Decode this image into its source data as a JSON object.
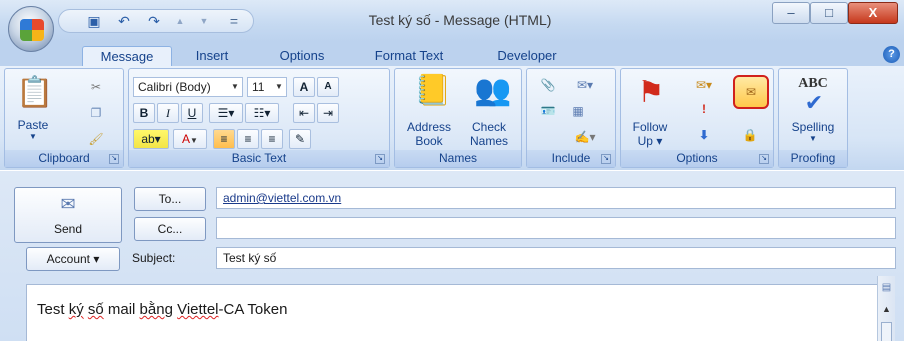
{
  "window": {
    "title": "Test ký số - Message (HTML)",
    "minimize": "–",
    "maximize": "□",
    "close": "X"
  },
  "qat": {
    "save_icon": "save-icon",
    "undo": "↶",
    "redo": "↷",
    "up": "▲",
    "down": "▼",
    "more": "="
  },
  "tabs": [
    "Message",
    "Insert",
    "Options",
    "Format Text",
    "Developer"
  ],
  "help": "?",
  "ribbon": {
    "clipboard": {
      "label": "Clipboard",
      "paste": "Paste"
    },
    "basic_text": {
      "label": "Basic Text",
      "font": "Calibri (Body)",
      "size": "11",
      "grow": "A",
      "shrink": "A",
      "bold": "B",
      "italic": "I",
      "underline": "U",
      "font_color": "A"
    },
    "names": {
      "label": "Names",
      "address_book": [
        "Address",
        "Book"
      ],
      "check_names": [
        "Check",
        "Names"
      ]
    },
    "include": {
      "label": "Include"
    },
    "options": {
      "label": "Options",
      "follow_up": [
        "Follow",
        "Up ▾"
      ]
    },
    "proofing": {
      "label": "Proofing",
      "spelling": "Spelling",
      "abc": "ABC"
    }
  },
  "form": {
    "send": "Send",
    "to_button": "To...",
    "cc_button": "Cc...",
    "to_value": "admin@viettel.com.vn",
    "cc_value": "",
    "account_button": "Account ▾",
    "subject_label": "Subject:",
    "subject_value": "Test ký số"
  },
  "body": {
    "w1": "Test ",
    "w2": "ký",
    "w3": " ",
    "w4": "số",
    "w5": " mail ",
    "w6": "bằng",
    "w7": " ",
    "w8": "Viettel",
    "w9": "-CA Token"
  },
  "colors": {
    "highlight_ring": "#d0201c",
    "ribbon_bg": "#dce8f7",
    "tab_text": "#15428b"
  }
}
